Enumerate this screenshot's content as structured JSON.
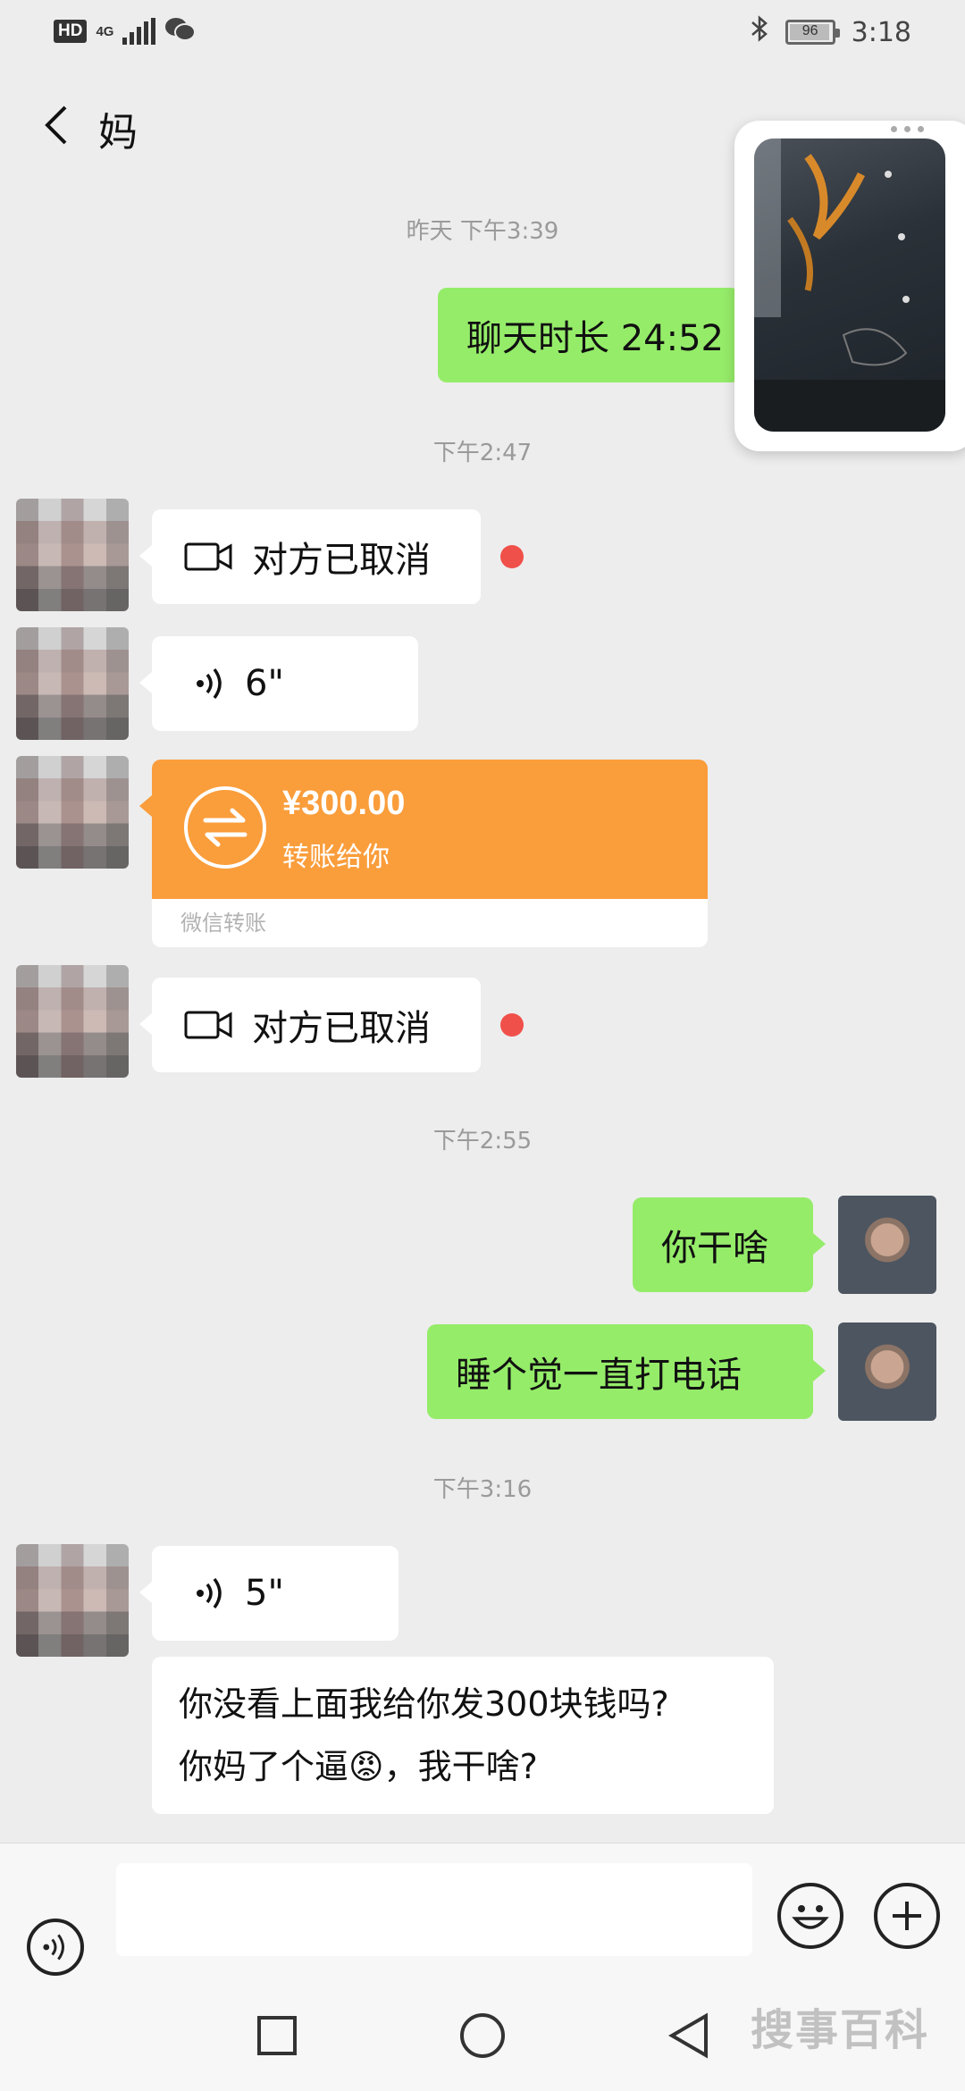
{
  "status_bar": {
    "hd": "HD",
    "network": "4G",
    "battery": "96",
    "battery_level": 0.96,
    "time": "3:18"
  },
  "header": {
    "title": "妈",
    "back_icon": "chevron-left-icon"
  },
  "messages": {
    "time_1": "昨天 下午3:39",
    "call_duration": "聊天时长 24:52",
    "time_2": "下午2:47",
    "video_cancel_1": "对方已取消",
    "voice_1_duration": "6\"",
    "transfer": {
      "amount": "¥300.00",
      "desc": "转账给你",
      "source": "微信转账"
    },
    "video_cancel_2": "对方已取消",
    "time_3": "下午2:55",
    "sent_1": "你干啥",
    "sent_2": "睡个觉一直打电话",
    "time_4": "下午3:16",
    "voice_2_duration": "5\"",
    "long_msg_line1": "你没看上面我给你发300块钱吗?",
    "long_msg_line2": "你妈了个逼😡，我干啥?"
  },
  "input_bar": {
    "placeholder": "",
    "voice_icon": "voice-icon",
    "emoji_icon": "emoji-icon",
    "plus_icon": "plus-icon"
  },
  "watermark": "搜事百科",
  "colors": {
    "background": "#ededed",
    "sent_bubble": "#95ec69",
    "transfer": "#fa9d3b",
    "unread": "#f0504a"
  }
}
